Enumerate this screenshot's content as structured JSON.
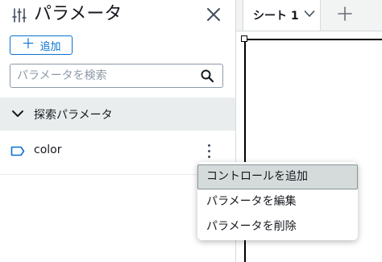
{
  "panel": {
    "title": "パラメータ",
    "add_button_label": "追加",
    "search_placeholder": "パラメータを検索",
    "section_label": "探索パラメータ",
    "parameters": [
      {
        "name": "color"
      }
    ]
  },
  "tabs": [
    {
      "label": "シート 1"
    }
  ],
  "context_menu": {
    "items": [
      {
        "label": "コントロールを追加"
      },
      {
        "label": "パラメータを編集"
      },
      {
        "label": "パラメータを削除"
      }
    ]
  },
  "icons": {
    "panel": "sliders-icon",
    "close": "close-icon",
    "add": "plus-icon",
    "search": "search-icon",
    "section": "chevron-down-icon",
    "parameter": "tag-icon",
    "row_menu": "kebab-icon",
    "tab_menu": "chevron-down-icon",
    "add_tab": "plus-icon"
  },
  "colors": {
    "accent": "#0972d3",
    "section_bg": "#eaeded",
    "menu_highlight": "#d5dbdb"
  }
}
